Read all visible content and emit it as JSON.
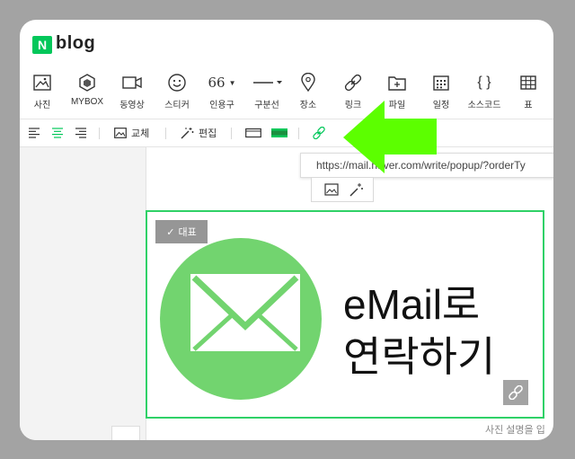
{
  "app": {
    "brand_letter": "N",
    "brand_name": "blog"
  },
  "toolbar": {
    "items": [
      {
        "icon": "photo-icon",
        "label": "사진"
      },
      {
        "icon": "mybox-icon",
        "label": "MYBOX"
      },
      {
        "icon": "video-icon",
        "label": "동영상"
      },
      {
        "icon": "sticker-icon",
        "label": "스티커"
      },
      {
        "icon": "quote-icon",
        "label": "인용구",
        "glyph": "66"
      },
      {
        "icon": "divider-icon",
        "label": "구분선"
      },
      {
        "icon": "location-icon",
        "label": "장소"
      },
      {
        "icon": "link-icon",
        "label": "링크"
      },
      {
        "icon": "file-icon",
        "label": "파일"
      },
      {
        "icon": "calendar-icon",
        "label": "일정"
      },
      {
        "icon": "code-icon",
        "label": "소스코드",
        "glyph": "{ }"
      },
      {
        "icon": "table-icon",
        "label": "표"
      }
    ]
  },
  "subbar": {
    "replace_label": "교체",
    "edit_label": "편집"
  },
  "link_tooltip": {
    "url": "https://mail.naver.com/write/popup/?orderTy"
  },
  "image": {
    "badge_label": "대표",
    "line1": "eMail로",
    "line2": "연락하기",
    "accent_color": "#2fd167",
    "circle_color": "#72d46f"
  },
  "caption": {
    "placeholder": "사진 설명을 입"
  }
}
